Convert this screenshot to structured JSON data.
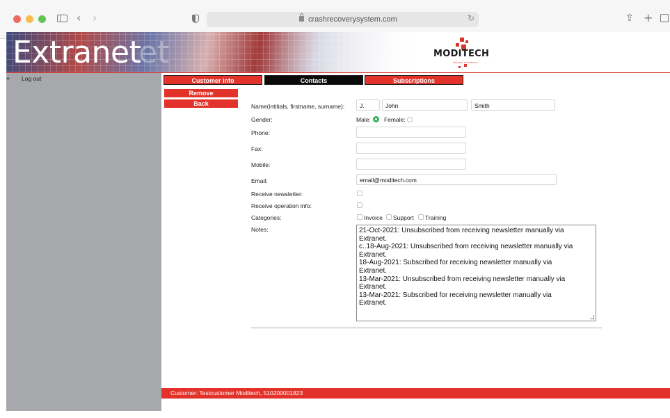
{
  "browser": {
    "url": "crashrecoverysystem.com"
  },
  "header": {
    "title": "Extranet",
    "ghost_title": "et",
    "logo_text": "MODITECH",
    "logo_sub": "rescue solutions",
    "accent_color": "#e2322a"
  },
  "sidebar": {
    "logout_prefix": "+",
    "logout_label": "Log out"
  },
  "tabs": [
    {
      "label": "Customer info"
    },
    {
      "label": "Contacts"
    },
    {
      "label": "Subscriptions"
    }
  ],
  "actions": {
    "remove_label": "Remove",
    "back_label": "Back"
  },
  "form": {
    "name_label": "Name(intitials, firstname, surname):",
    "initials": "J.",
    "firstname": "John",
    "surname": "Smith",
    "gender_label": "Gender:",
    "male_label": "Male:",
    "female_label": "Female:",
    "phone_label": "Phone:",
    "phone": "",
    "fax_label": "Fax:",
    "fax": "",
    "mobile_label": "Mobile:",
    "mobile": "",
    "email_label": "Email:",
    "email": "email@moditech.com",
    "newsletter_label": "Receive newsletter:",
    "operation_label": "Receive operation info:",
    "categories_label": "Categories:",
    "categories": [
      {
        "label": "Invoice"
      },
      {
        "label": "Support"
      },
      {
        "label": "Training"
      }
    ],
    "notes_label": "Notes:",
    "notes": [
      "21-Oct-2021: Unsubscribed from receiving newsletter manually via",
      "Extranet.",
      "c..18-Aug-2021: Unsubscribed from receiving newsletter manually via",
      "Extranet.",
      "18-Aug-2021: Subscribed for receiving newsletter manually via",
      "Extranet.",
      "13-Mar-2021: Unsubscribed from receiving newsletter manually via",
      "Extranet.",
      "13-Mar-2021: Subscribed for receiving newsletter manually via",
      "Extranet."
    ]
  },
  "footer": {
    "text": "Customer: Testcustomer Moditech, 510200001823"
  }
}
